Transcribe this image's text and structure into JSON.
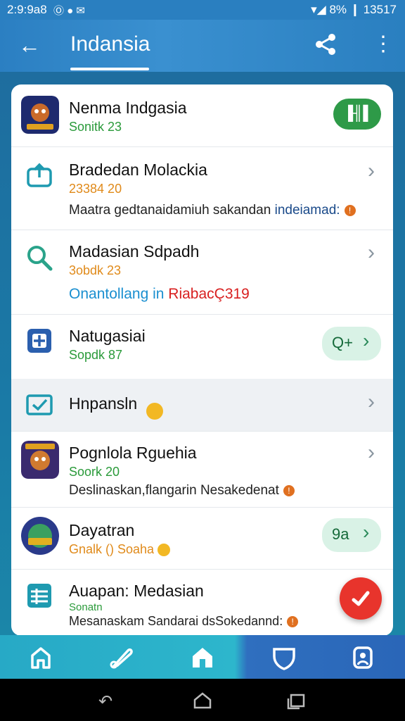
{
  "status": {
    "time": "2:9:9a8",
    "icons": "Ⓞ ● ✉",
    "right": "▾◢ 8% ❙ 13517"
  },
  "appbar": {
    "title": "Indansia"
  },
  "items": [
    {
      "title": "Nenma Indgasia",
      "sub": "Sonitk 23",
      "sub_color": "#2a9a3a",
      "desc": "",
      "desc_right": "",
      "button_label": "▐╢▌"
    },
    {
      "title": "Bradedan Molackia",
      "sub": "23384 20",
      "sub_color": "#e08a1a",
      "desc": "Maatra gedtanaidamiuh sakandan ",
      "desc_right": "indeiamad:",
      "button_label": ""
    },
    {
      "title": "Madasian Sdpadh",
      "sub": "3obdk 23",
      "sub_color": "#e08a1a",
      "desc": "Onantollang in ",
      "desc_right": "RiabacÇ319",
      "button_label": ""
    },
    {
      "title": "Natugasiai",
      "sub": "Sopdk 87",
      "sub_color": "#2a9a3a",
      "desc": "",
      "desc_right": "",
      "button_label": "Q+"
    },
    {
      "title": "Hnpansln",
      "sub": "",
      "sub_color": "#2a9a3a",
      "desc": "",
      "desc_right": "",
      "button_label": ""
    },
    {
      "title": "Pognlola Rguehia",
      "sub": "Soork 20",
      "sub_color": "#2a9a3a",
      "desc": "Deslinaskan,flangarin Nesakedenat",
      "desc_right": "",
      "button_label": ""
    },
    {
      "title": "Dayatran",
      "sub": "Gnalk () Soaha",
      "sub_color": "#e08a1a",
      "desc": "",
      "desc_right": "",
      "button_label": "9a"
    },
    {
      "title": "Auapan: Medasian",
      "sub": "Sonatn",
      "sub_color": "#2a9a3a",
      "desc": "Mesanaskam Sandarai dsSokedannd:",
      "desc_right": "",
      "button_label": ""
    }
  ],
  "nav": [
    "home-icon",
    "feather-icon",
    "house-icon",
    "shield-icon",
    "badge-icon"
  ],
  "sysnav": [
    "back-icon",
    "home-icon",
    "recents-icon"
  ],
  "colors": {
    "accent": "#2a7fc0",
    "green": "#2a9a3a",
    "orange": "#e08a1a",
    "fab": "#e8342c"
  }
}
